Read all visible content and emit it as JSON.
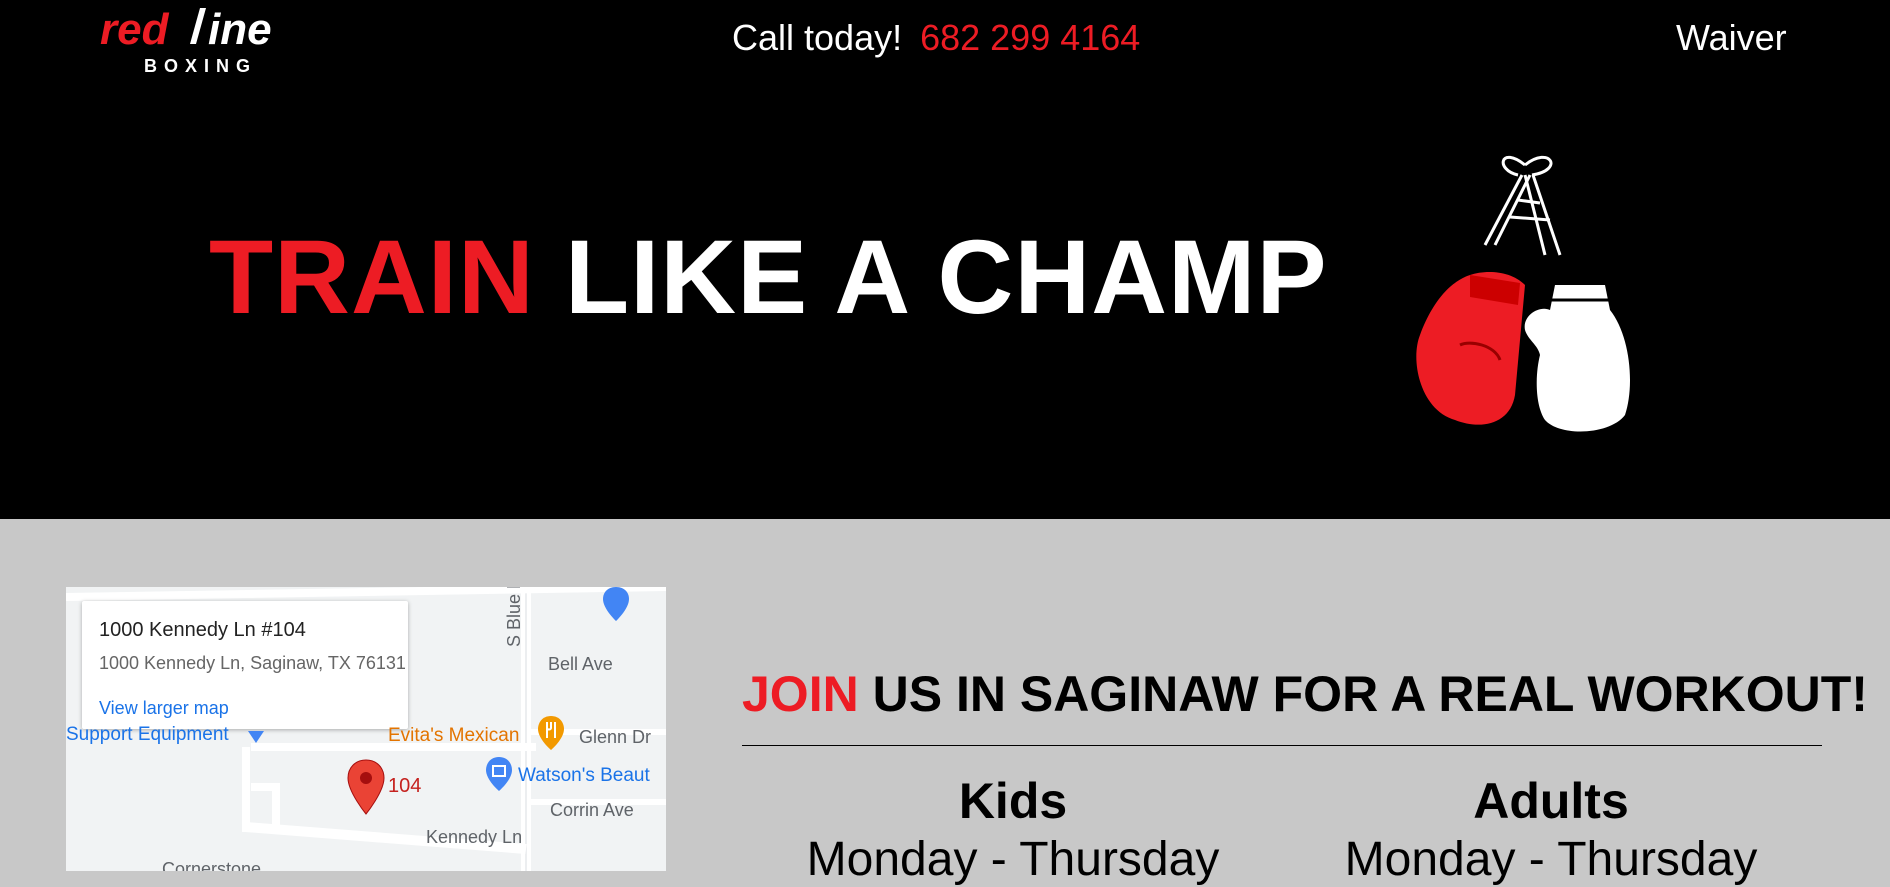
{
  "header": {
    "logo": {
      "word_main": "redline",
      "word_sub": "BOXING"
    },
    "call_label": "Call today!",
    "phone": "682 299 4164",
    "waiver_label": "Waiver"
  },
  "hero": {
    "red_word": "TRAIN",
    "rest": "LIKE A CHAMP"
  },
  "map": {
    "card_title": "1000 Kennedy Ln #104",
    "card_address": "1000 Kennedy Ln, Saginaw, TX 76131",
    "card_link": "View larger map",
    "labels": {
      "support": "Support Equipment",
      "evitas": "Evita's Mexican",
      "glenn": "Glenn Dr",
      "bell": "Bell Ave",
      "watsons": "Watson's Beaut",
      "corrin": "Corrin Ave",
      "kennedy": "Kennedy Ln",
      "blue": "S Blue M",
      "cornerstone": "Cornerstone",
      "pin": "104"
    }
  },
  "join": {
    "red_word": "JOIN",
    "rest": "US IN SAGINAW FOR A REAL WORKOUT!"
  },
  "schedule": {
    "kids": {
      "title": "Kids",
      "days": "Monday - Thursday"
    },
    "adults": {
      "title": "Adults",
      "days": "Monday - Thursday"
    }
  },
  "colors": {
    "accent": "#ed1c24",
    "header_bg": "#000000",
    "body_bg": "#c8c8c8",
    "link": "#1a73e8"
  }
}
